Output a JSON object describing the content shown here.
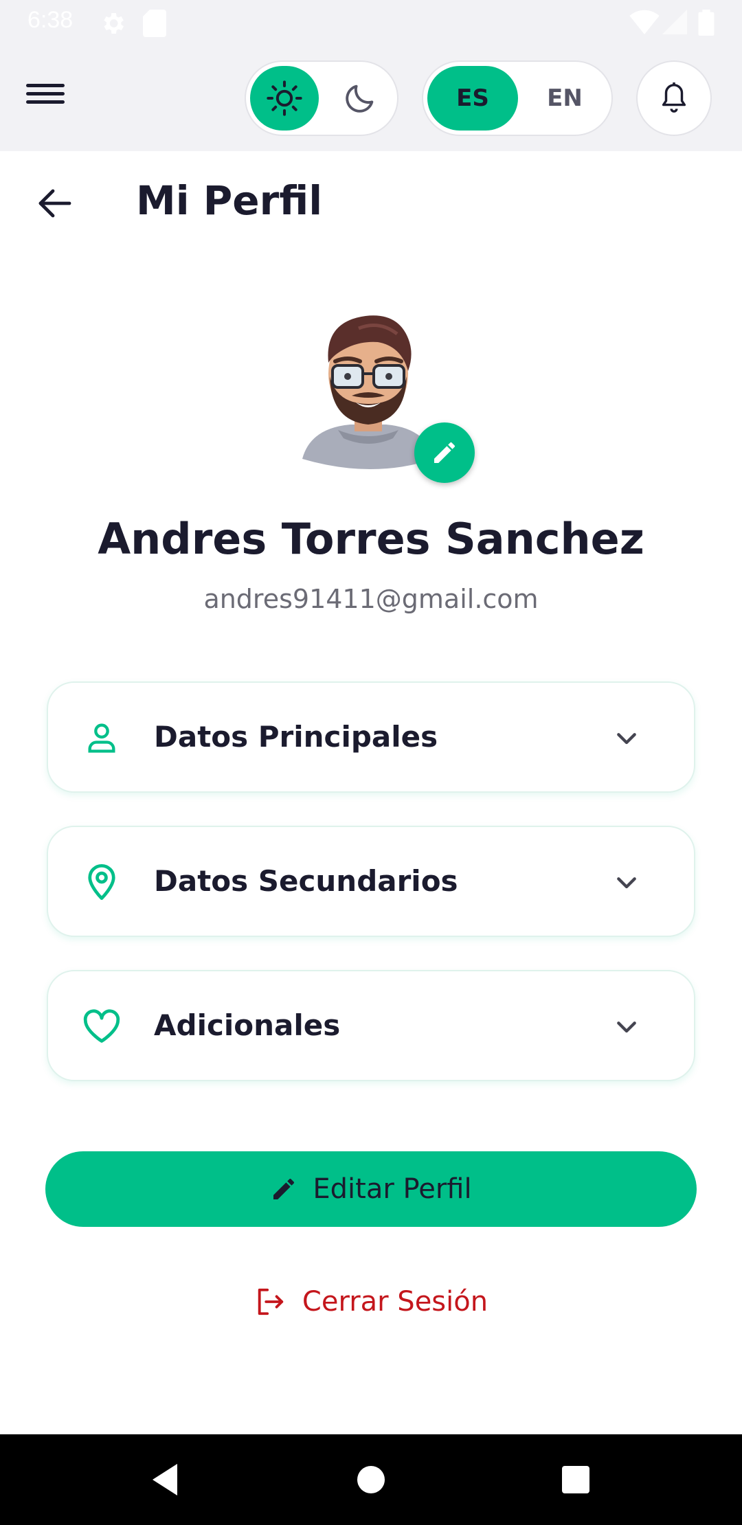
{
  "status_bar": {
    "time": "6:38"
  },
  "app_bar": {
    "theme_toggle": {
      "selected": "light",
      "light_icon": "sun-icon",
      "dark_icon": "moon-icon"
    },
    "language_toggle": {
      "options": [
        "ES",
        "EN"
      ],
      "selected": "ES"
    },
    "notifications_icon": "bell-icon"
  },
  "header": {
    "title": "Mi Perfil"
  },
  "profile": {
    "name": "Andres Torres Sanchez",
    "email": "andres91411@gmail.com"
  },
  "sections": [
    {
      "label": "Datos Principales",
      "icon": "user-icon"
    },
    {
      "label": "Datos Secundarios",
      "icon": "location-pin-icon"
    },
    {
      "label": "Adicionales",
      "icon": "heart-icon"
    }
  ],
  "actions": {
    "edit_profile": "Editar Perfil",
    "logout": "Cerrar Sesión"
  },
  "colors": {
    "accent": "#00bf89",
    "danger": "#c4161c",
    "text_dark": "#1b1b2e",
    "appbar_bg": "#f2f2f5"
  }
}
